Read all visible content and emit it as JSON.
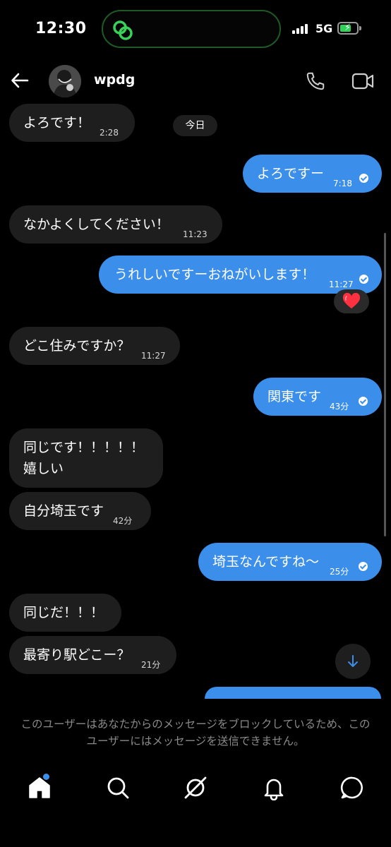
{
  "status_bar": {
    "time": "12:30",
    "network": "5G",
    "battery_charging": true
  },
  "header": {
    "username": "wpdg"
  },
  "date_divider": "今日",
  "messages": [
    {
      "dir": "in",
      "text": "よろです！",
      "time": "2:28"
    },
    {
      "dir": "out",
      "text": "よろですー",
      "time": "7:18",
      "read": true
    },
    {
      "dir": "in",
      "text": "なかよくしてください！",
      "time": "11:23"
    },
    {
      "dir": "out",
      "text": "うれしいですーおねがいします！",
      "time": "11:27",
      "read": true,
      "reaction": "heart"
    },
    {
      "dir": "in",
      "text": "どこ住みですか？",
      "time": "11:27"
    },
    {
      "dir": "out",
      "text": "関東です",
      "time": "43分",
      "read": true
    },
    {
      "dir": "in",
      "lines": [
        "同じです！！！！！",
        "嬉しい"
      ]
    },
    {
      "dir": "in",
      "text": "自分埼玉です",
      "time": "42分"
    },
    {
      "dir": "out",
      "text": "埼玉なんですね〜",
      "time": "25分",
      "read": true
    },
    {
      "dir": "in",
      "text": "同じだ！！！"
    },
    {
      "dir": "in",
      "text": "最寄り駅どこー？",
      "time": "21分"
    }
  ],
  "blocked_notice": "このユーザーはあなたからのメッセージをブロックしているため、このユーザーにはメッセージを送信できません。",
  "bottom_nav": [
    "home",
    "search",
    "explore",
    "notifications",
    "messages"
  ],
  "colors": {
    "outgoing_bubble": "#3b8eea",
    "incoming_bubble": "#1e1e1e",
    "background": "#000000"
  }
}
